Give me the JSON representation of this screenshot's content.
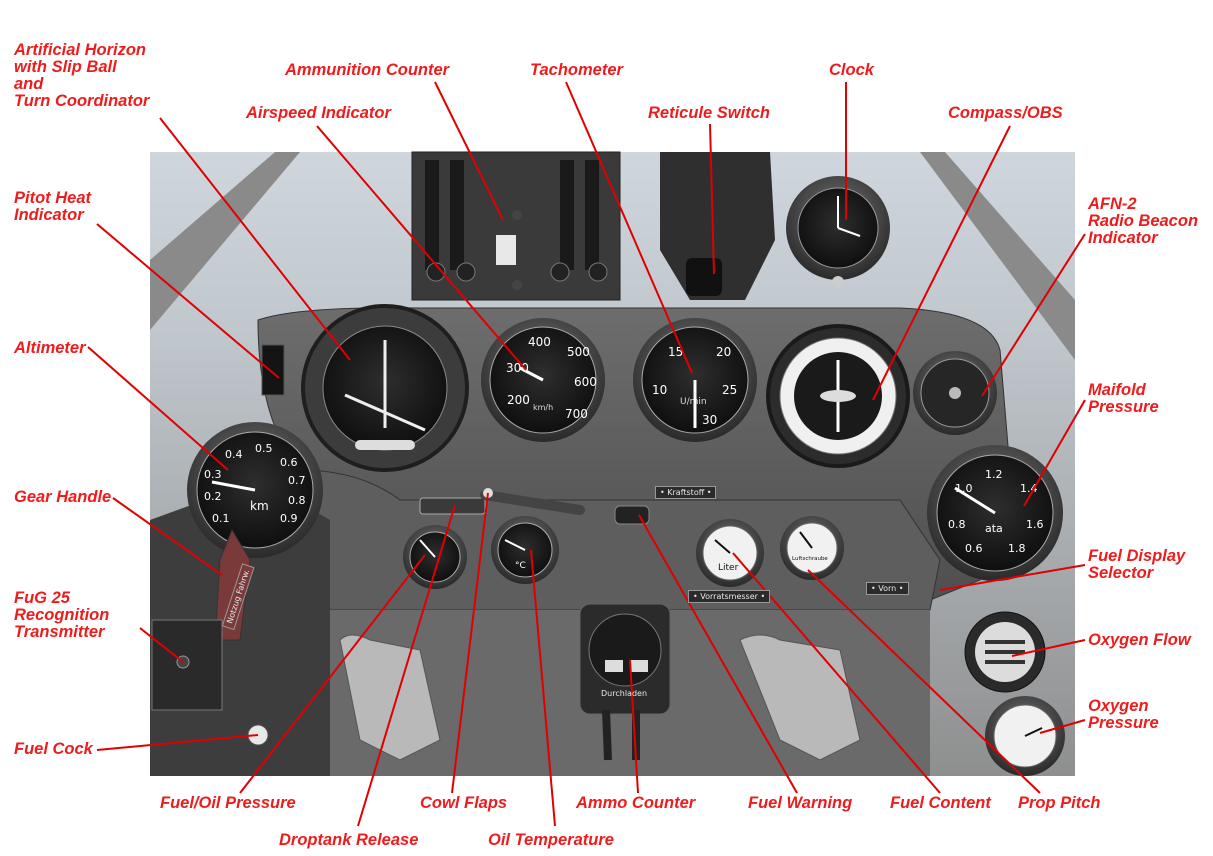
{
  "labels": {
    "artificial_horizon": [
      "Artificial Horizon",
      "with Slip Ball",
      "and",
      "Turn Coordinator"
    ],
    "ammunition_counter": [
      "Ammunition Counter"
    ],
    "tachometer": [
      "Tachometer"
    ],
    "clock": [
      "Clock"
    ],
    "airspeed_indicator": [
      "Airspeed Indicator"
    ],
    "reticule_switch": [
      "Reticule Switch"
    ],
    "compass_obs": [
      "Compass/OBS"
    ],
    "pitot_heat": [
      "Pitot Heat",
      "Indicator"
    ],
    "afn2": [
      "AFN-2",
      "Radio Beacon",
      "Indicator"
    ],
    "altimeter": [
      "Altimeter"
    ],
    "manifold_pressure": [
      "Maifold",
      "Pressure"
    ],
    "gear_handle": [
      "Gear Handle"
    ],
    "fuel_display_selector": [
      "Fuel Display",
      "Selector"
    ],
    "fug25": [
      "FuG 25",
      "Recognition",
      "Transmitter"
    ],
    "oxygen_flow": [
      "Oxygen Flow"
    ],
    "oxygen_pressure": [
      "Oxygen",
      "Pressure"
    ],
    "fuel_cock": [
      "Fuel Cock"
    ],
    "fuel_oil_pressure": [
      "Fuel/Oil Pressure"
    ],
    "cowl_flaps": [
      "Cowl Flaps"
    ],
    "ammo_counter": [
      "Ammo Counter"
    ],
    "fuel_warning": [
      "Fuel Warning"
    ],
    "fuel_content": [
      "Fuel Content"
    ],
    "prop_pitch": [
      "Prop Pitch"
    ],
    "droptank_release": [
      "Droptank Release"
    ],
    "oil_temperature": [
      "Oil Temperature"
    ]
  },
  "gauges": {
    "airspeed": {
      "ticks": [
        "400",
        "500",
        "300",
        "600",
        "200",
        "700"
      ],
      "unit": "km/h"
    },
    "tachometer": {
      "ticks": [
        "15",
        "20",
        "10",
        "25",
        "30"
      ],
      "unit": "U/min"
    },
    "altimeter": {
      "ticks": [
        "0.4",
        "0.5",
        "0.6",
        "0.3",
        "0.7",
        "0.2",
        "0.8",
        "0.1",
        "0.9"
      ],
      "unit": "km"
    },
    "manifold": {
      "ticks": [
        "1.2",
        "1.0",
        "1.4",
        "0.8",
        "1.6",
        "0.6",
        "1.8"
      ],
      "unit": "ata"
    },
    "fuel_content": {
      "unit": "Liter"
    },
    "prop_pitch": {
      "unit": "Luftschraube"
    },
    "oil_temp": {
      "unit": "°C"
    }
  },
  "placards": {
    "kraftstoff": "• Kraftstoff •",
    "vorratsmesser": "• Vorratsmesser •",
    "vorn": "• Vorn •",
    "durchladen": "Durchladen",
    "notzug": "Notzug Fahrw."
  },
  "colors": {
    "callout": "#ee1c1c",
    "leader": "#e00000"
  }
}
